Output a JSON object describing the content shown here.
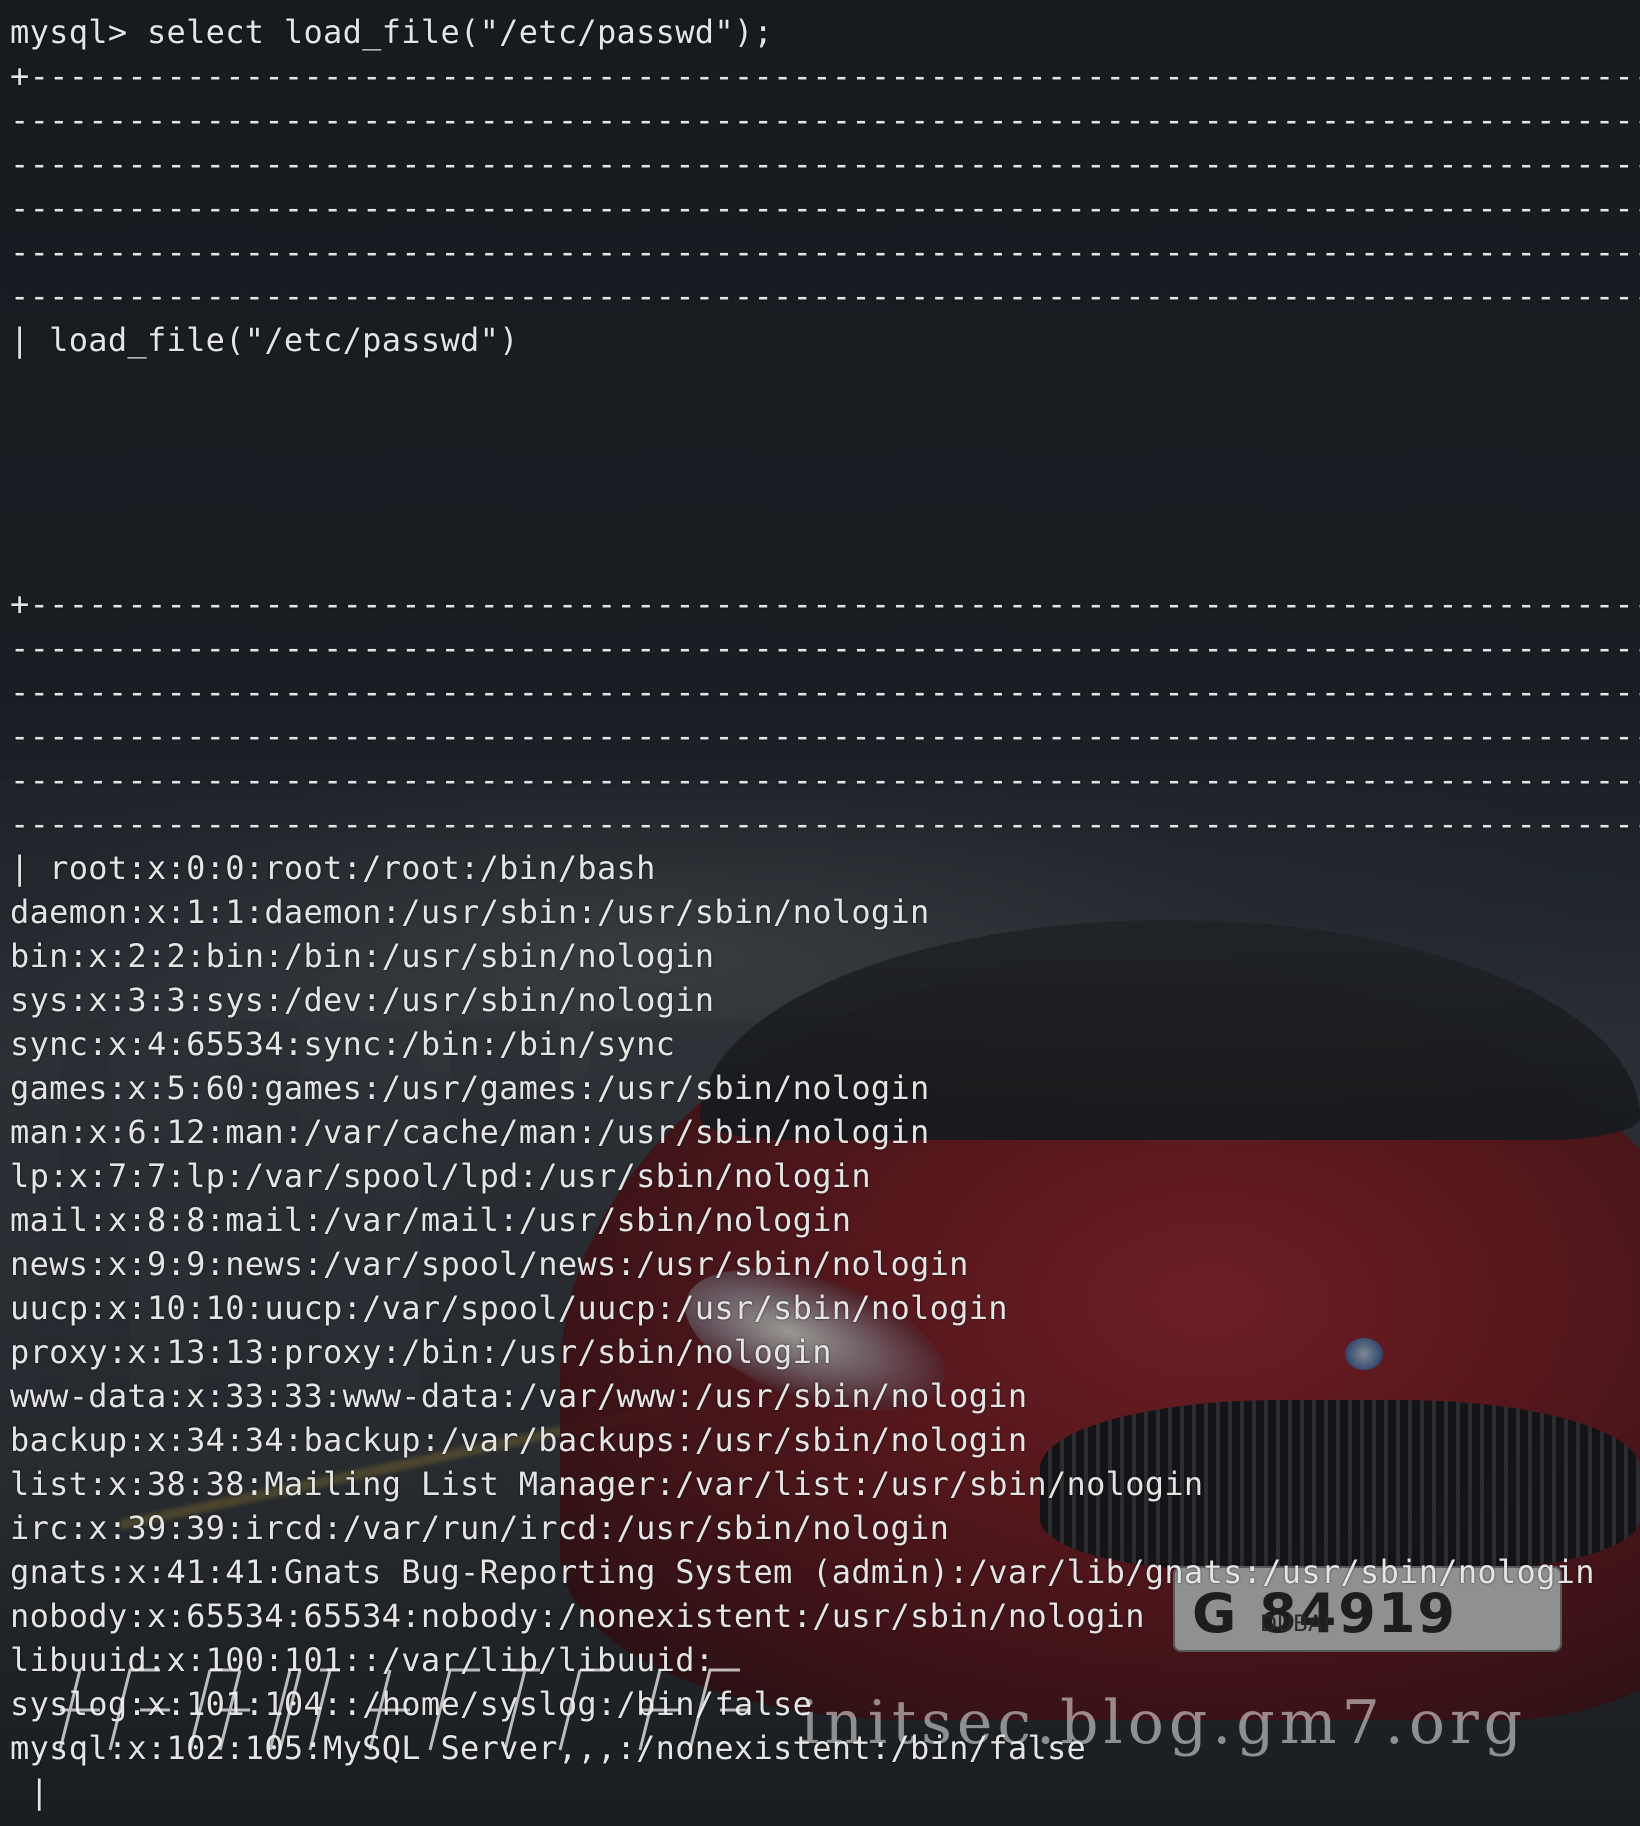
{
  "terminal": {
    "command_line": "mysql> select load_file(\"/etc/passwd\");",
    "border_top": "+---------------------------------------------------------------------------------------",
    "border_dash": "----------------------------------------------------------------------------------------",
    "header_cell": "| load_file(\"/etc/passwd\")",
    "border_mid": "+---------------------------------------------------------------------------------------",
    "passwd_lines": [
      "| root:x:0:0:root:/root:/bin/bash",
      "daemon:x:1:1:daemon:/usr/sbin:/usr/sbin/nologin",
      "bin:x:2:2:bin:/bin:/usr/sbin/nologin",
      "sys:x:3:3:sys:/dev:/usr/sbin/nologin",
      "sync:x:4:65534:sync:/bin:/bin/sync",
      "games:x:5:60:games:/usr/games:/usr/sbin/nologin",
      "man:x:6:12:man:/var/cache/man:/usr/sbin/nologin",
      "lp:x:7:7:lp:/var/spool/lpd:/usr/sbin/nologin",
      "mail:x:8:8:mail:/var/mail:/usr/sbin/nologin",
      "news:x:9:9:news:/var/spool/news:/usr/sbin/nologin",
      "uucp:x:10:10:uucp:/var/spool/uucp:/usr/sbin/nologin",
      "proxy:x:13:13:proxy:/bin:/usr/sbin/nologin",
      "www-data:x:33:33:www-data:/var/www:/usr/sbin/nologin",
      "backup:x:34:34:backup:/var/backups:/usr/sbin/nologin",
      "list:x:38:38:Mailing List Manager:/var/list:/usr/sbin/nologin",
      "irc:x:39:39:ircd:/var/run/ircd:/usr/sbin/nologin",
      "gnats:x:41:41:Gnats Bug-Reporting System (admin):/var/lib/gnats:/usr/sbin/nologin",
      "nobody:x:65534:65534:nobody:/nonexistent:/usr/sbin/nologin",
      "libuuid:x:100:101::/var/lib/libuuid:",
      "syslog:x:101:104::/home/syslog:/bin/false",
      "mysql:x:102:105:MySQL Server,,,:/nonexistent:/bin/false",
      " |"
    ]
  },
  "wallpaper": {
    "plate_number": "G 84919",
    "plate_city": "DUBAI"
  },
  "watermark": {
    "text": "initsec.blog.gm7.org"
  },
  "colors": {
    "terminal_text": "#e4e4e4",
    "terminal_bg": "#1d2126",
    "car_red": "#8c1419"
  }
}
